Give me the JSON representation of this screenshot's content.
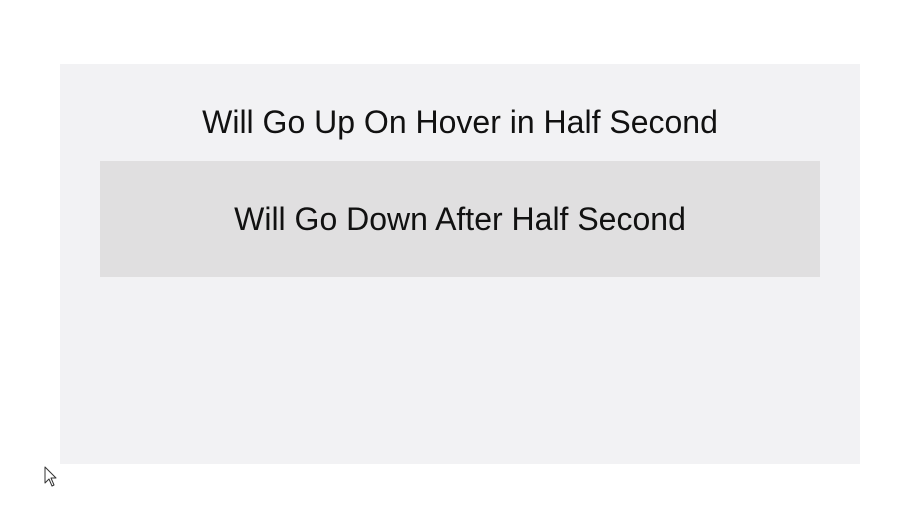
{
  "demo": {
    "heading": "Will Go Up On Hover in Half Second",
    "box_label": "Will Go Down After Half Second"
  },
  "colors": {
    "page_background": "#ffffff",
    "container_background": "#f2f2f4",
    "box_background": "#e0dfe0",
    "text": "#111111"
  },
  "icons": {
    "cursor": "mouse-pointer-icon"
  }
}
